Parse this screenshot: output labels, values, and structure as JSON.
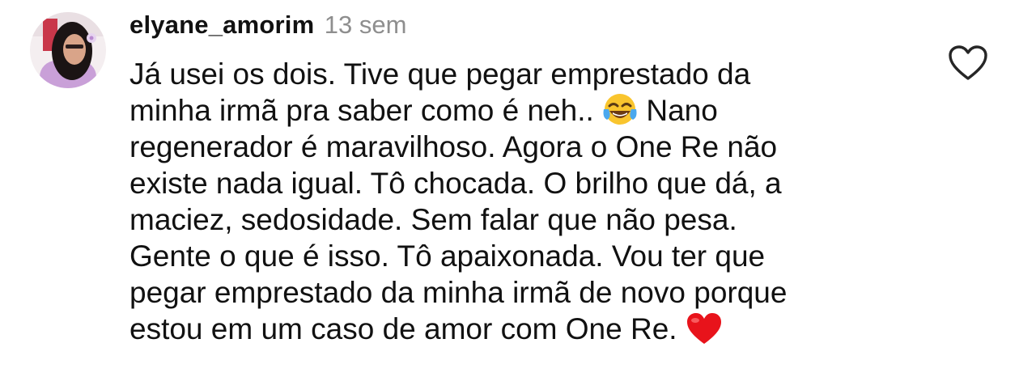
{
  "comment": {
    "username": "elyane_amorim",
    "time": "13 sem",
    "lines": [
      "Já usei os dois. Tive que pegar emprestado da",
      "minha irmã pra saber como é neh..",
      "Nano",
      "regenerador é maravilhoso. Agora o One Re não",
      "existe nada igual. Tô chocada. O brilho que dá, a",
      "maciez, sedosidade. Sem falar que não pesa.",
      "Gente o que é isso. Tô apaixonada. Vou ter que",
      "pegar emprestado da minha irmã de novo porque",
      "estou em um caso de amor com One Re."
    ],
    "emojis": [
      "face-with-tears-of-joy-emoji",
      "red-heart-emoji"
    ]
  },
  "icons": {
    "like": "heart-outline-icon"
  },
  "colors": {
    "text": "#111111",
    "timestamp": "#8e8e8e",
    "like_icon": "#262626",
    "heart_emoji": "#e8131b",
    "joy_emoji": "#f9c52e"
  }
}
